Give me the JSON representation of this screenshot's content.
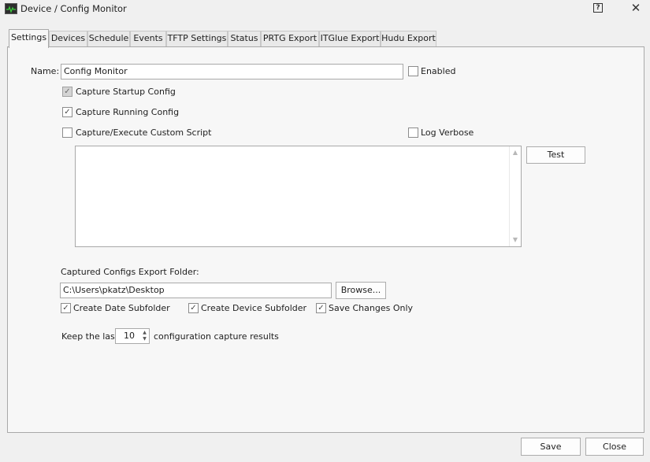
{
  "window": {
    "title": "Device / Config Monitor",
    "help_glyph": "?",
    "close_glyph": "✕"
  },
  "tabs": [
    {
      "label": "Settings",
      "active": true
    },
    {
      "label": "Devices"
    },
    {
      "label": "Schedule"
    },
    {
      "label": "Events"
    },
    {
      "label": "TFTP Settings"
    },
    {
      "label": "Status"
    },
    {
      "label": "PRTG Export"
    },
    {
      "label": "ITGlue Export"
    },
    {
      "label": "Hudu Export"
    }
  ],
  "settings": {
    "name_label": "Name:",
    "name_value": "Config Monitor",
    "enabled_label": "Enabled",
    "enabled_checked": false,
    "capture_startup_label": "Capture Startup Config",
    "capture_startup_checked": true,
    "capture_running_label": "Capture Running Config",
    "capture_running_checked": true,
    "custom_script_label": "Capture/Execute Custom Script",
    "custom_script_checked": false,
    "log_verbose_label": "Log Verbose",
    "log_verbose_checked": false,
    "script_text": "",
    "test_button": "Test",
    "export_folder_label": "Captured Configs Export Folder:",
    "export_folder_value": "C:\\Users\\pkatz\\Desktop",
    "browse_button": "Browse...",
    "date_subfolder_label": "Create Date Subfolder",
    "device_subfolder_label": "Create Device Subfolder",
    "save_changes_only_label": "Save Changes Only",
    "keep_prefix": "Keep the last",
    "keep_value": "10",
    "keep_suffix": "configuration capture results"
  },
  "footer": {
    "save_button": "Save",
    "close_button": "Close"
  },
  "icons": {
    "check": "✓",
    "scroll_up": "▲",
    "scroll_down": "▼",
    "spin_up": "▲",
    "spin_down": "▼"
  },
  "colors": {
    "background": "#f0f0f0",
    "panel": "#f7f7f7",
    "border": "#a9a9a9"
  }
}
